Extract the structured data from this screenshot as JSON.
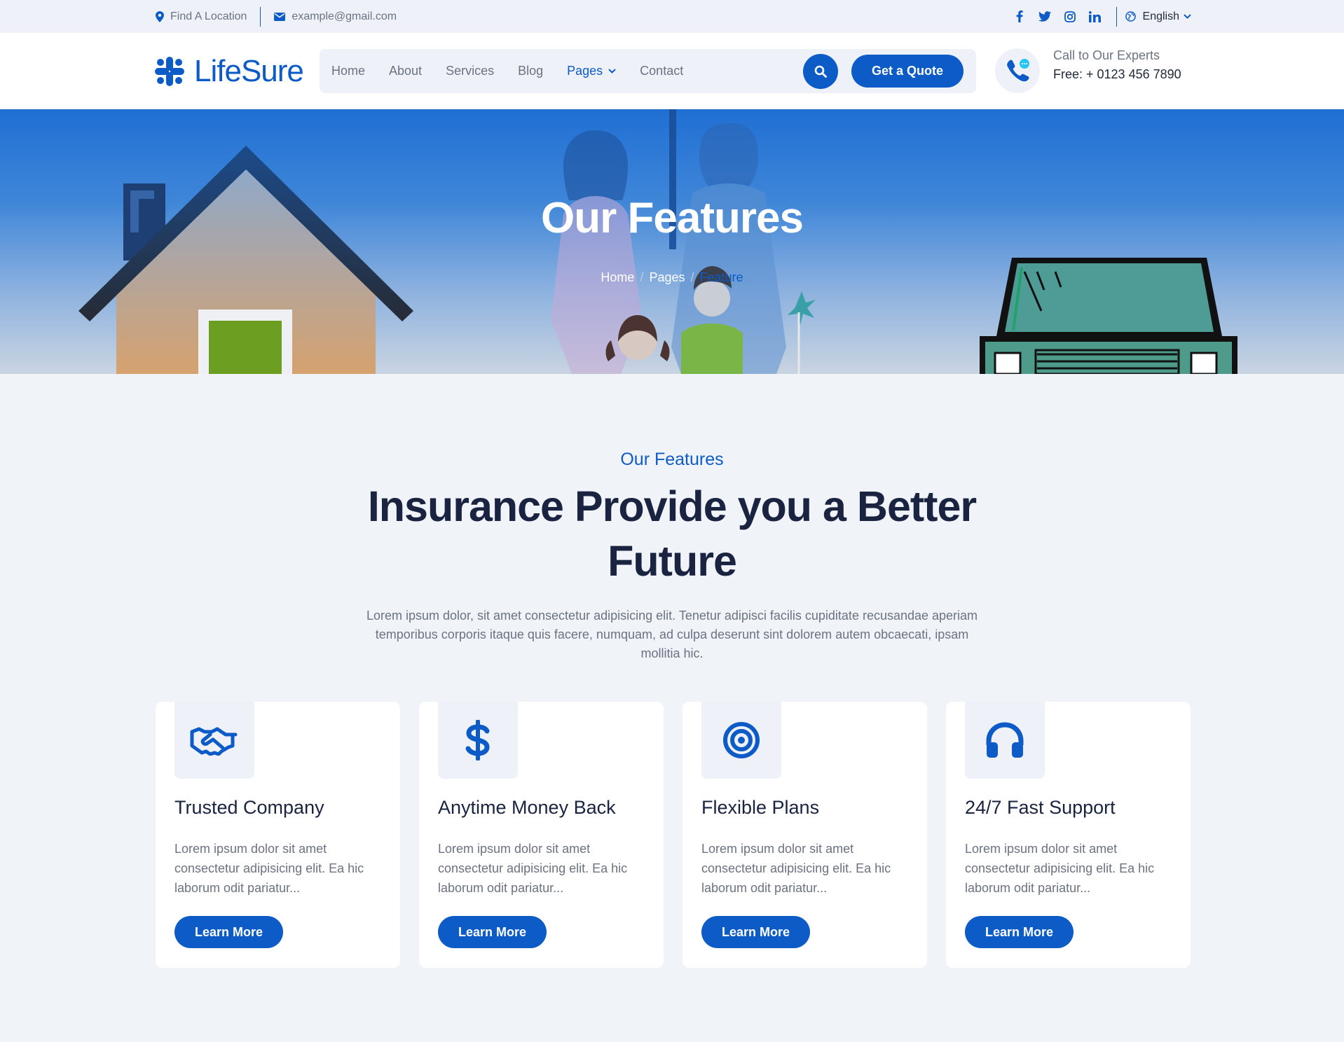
{
  "topbar": {
    "location": "Find A Location",
    "email": "example@gmail.com",
    "social": [
      "facebook-icon",
      "twitter-icon",
      "instagram-icon",
      "linkedin-icon"
    ],
    "language": "English"
  },
  "header": {
    "logo": "LifeSure",
    "nav": [
      {
        "label": "Home"
      },
      {
        "label": "About"
      },
      {
        "label": "Services"
      },
      {
        "label": "Blog"
      },
      {
        "label": "Pages"
      },
      {
        "label": "Contact"
      }
    ],
    "quote_label": "Get a Quote",
    "call_line1": "Call to Our Experts",
    "call_line2": "Free: + 0123 456 7890"
  },
  "hero": {
    "title": "Our Features",
    "breadcrumb": [
      "Home",
      "Pages",
      "Feature"
    ],
    "separator": "/"
  },
  "section": {
    "subtitle": "Our Features",
    "title": "Insurance Provide you a Better Future",
    "description": "Lorem ipsum dolor, sit amet consectetur adipisicing elit. Tenetur adipisci facilis cupiditate recusandae aperiam temporibus corporis itaque quis facere, numquam, ad culpa deserunt sint dolorem autem obcaecati, ipsam mollitia hic."
  },
  "cards": [
    {
      "icon": "handshake-icon",
      "title": "Trusted Company",
      "text": "Lorem ipsum dolor sit amet consectetur adipisicing elit. Ea hic laborum odit pariatur...",
      "button": "Learn More"
    },
    {
      "icon": "dollar-icon",
      "title": "Anytime Money Back",
      "text": "Lorem ipsum dolor sit amet consectetur adipisicing elit. Ea hic laborum odit pariatur...",
      "button": "Learn More"
    },
    {
      "icon": "target-icon",
      "title": "Flexible Plans",
      "text": "Lorem ipsum dolor sit amet consectetur adipisicing elit. Ea hic laborum odit pariatur...",
      "button": "Learn More"
    },
    {
      "icon": "headphones-icon",
      "title": "24/7 Fast Support",
      "text": "Lorem ipsum dolor sit amet consectetur adipisicing elit. Ea hic laborum odit pariatur...",
      "button": "Learn More"
    }
  ],
  "colors": {
    "primary": "#0d5bc7",
    "heading": "#1a2340",
    "background": "#f0f4f9"
  }
}
